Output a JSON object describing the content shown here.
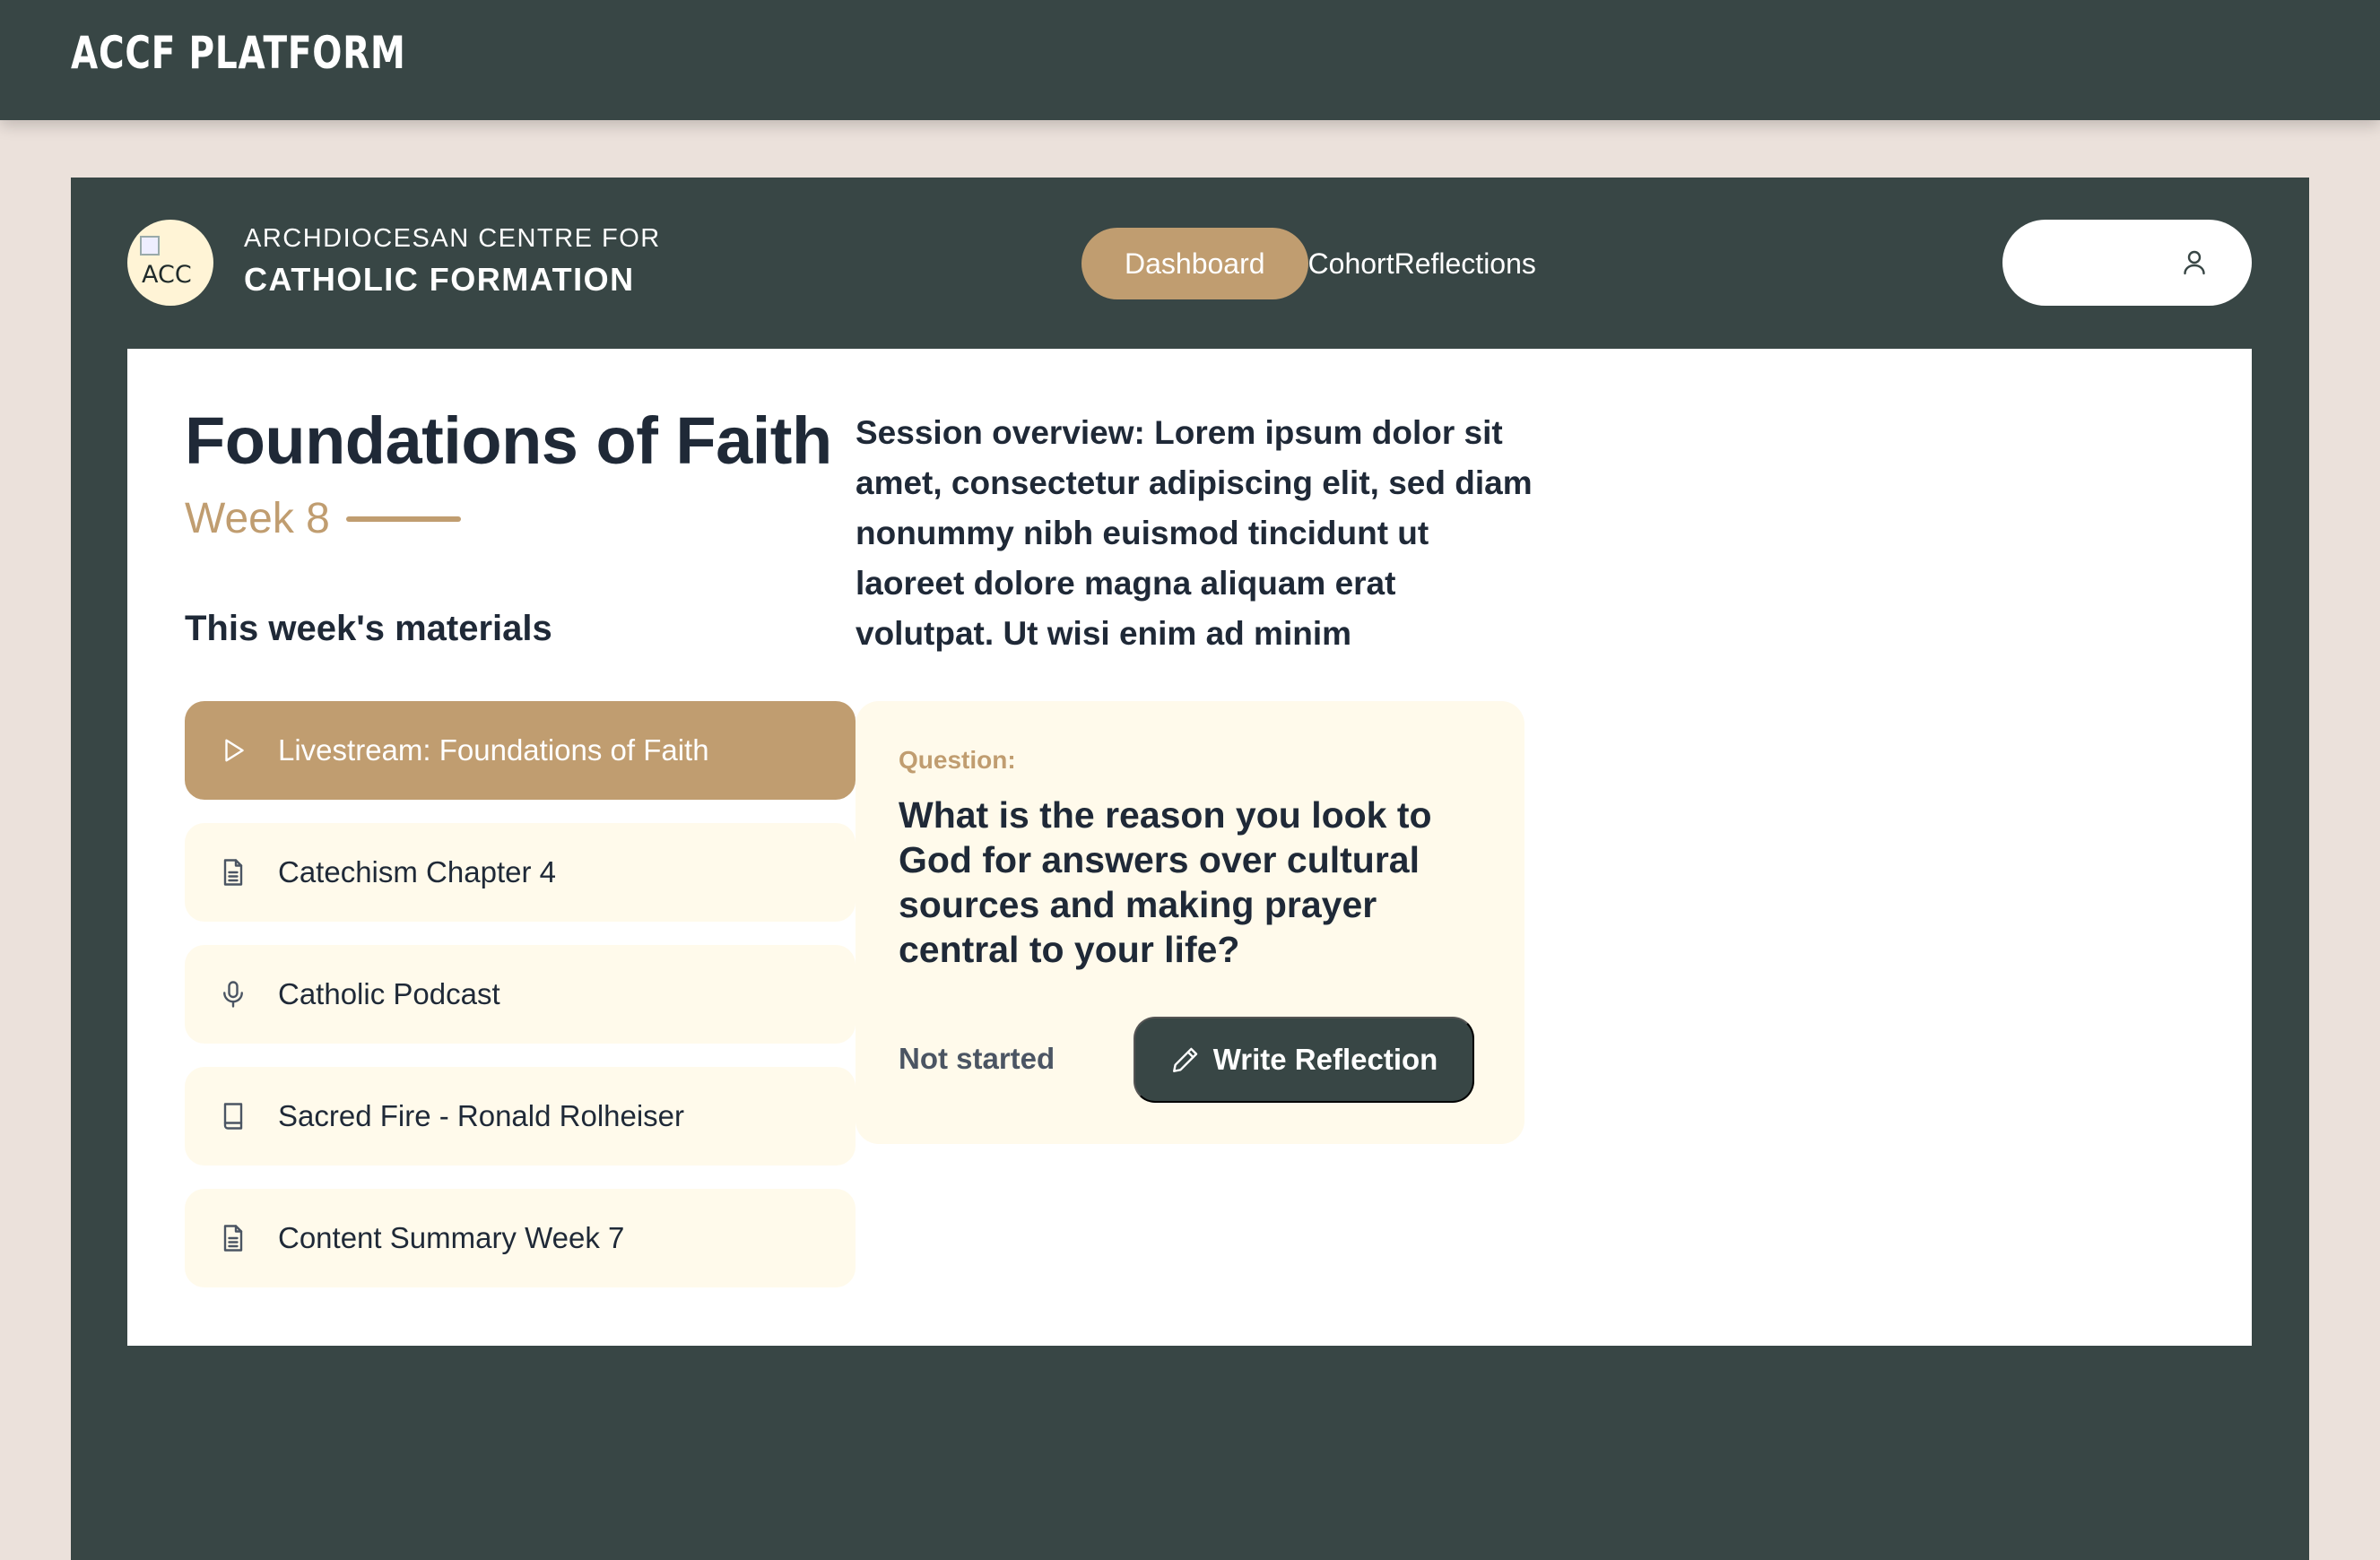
{
  "app": {
    "title": "ACCF PLATFORM"
  },
  "brand": {
    "logo_alt": "ACC",
    "line1": "ARCHDIOCESAN CENTRE FOR",
    "line2": "CATHOLIC FORMATION"
  },
  "nav": {
    "items": [
      {
        "label": "Dashboard",
        "active": true
      },
      {
        "label": "Cohort",
        "active": false
      },
      {
        "label": "Reflections",
        "active": false
      }
    ]
  },
  "user": {
    "icon": "user-icon"
  },
  "course": {
    "title": "Foundations of Faith",
    "week": "Week 8"
  },
  "materials": {
    "heading": "This week's materials",
    "items": [
      {
        "label": "Livestream: Foundations of Faith",
        "icon": "play-icon",
        "active": true
      },
      {
        "label": "Catechism Chapter 4",
        "icon": "document-icon",
        "active": false
      },
      {
        "label": "Catholic Podcast",
        "icon": "microphone-icon",
        "active": false
      },
      {
        "label": "Sacred Fire - Ronald Rolheiser",
        "icon": "book-icon",
        "active": false
      },
      {
        "label": "Content Summary Week 7",
        "icon": "document-icon",
        "active": false
      }
    ]
  },
  "overview": {
    "text": "Session overview: Lorem ipsum dolor sit amet, consectetur adipiscing elit, sed diam nonummy nibh euismod tincidunt ut laoreet dolore magna aliquam erat volutpat. Ut wisi enim ad minim"
  },
  "question": {
    "label": "Question:",
    "text": "What is the reason you look to God for answers over cultural sources and making prayer central to your life?",
    "status": "Not started",
    "button_label": "Write Reflection",
    "button_icon": "pencil-icon"
  },
  "colors": {
    "dark": "#384645",
    "accent": "#c09d70",
    "cream": "#fffaeb",
    "background": "#ebe1db"
  }
}
